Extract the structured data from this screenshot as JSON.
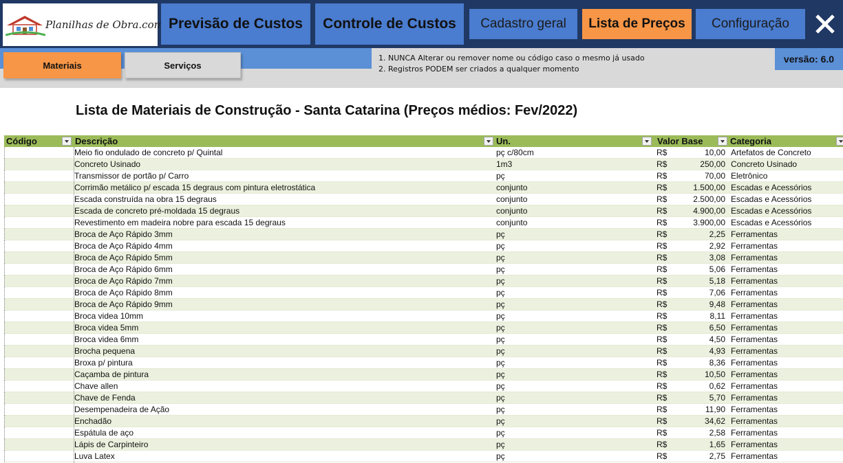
{
  "logo": {
    "text": "Planilhas de Obra.com"
  },
  "nav": {
    "previsao": "Previsão de Custos",
    "controle": "Controle de Custos",
    "cadastro": "Cadastro geral",
    "lista": "Lista de Preços",
    "config": "Configuração"
  },
  "tabs": {
    "materiais": "Materiais",
    "servicos": "Serviços"
  },
  "notes": [
    "1.  NUNCA Alterar ou remover nome ou código caso o mesmo já usado",
    "2.  Registros PODEM ser criados a qualquer momento"
  ],
  "version": "versão: 6.0",
  "title": "Lista de Materiais de Construção - Santa Catarina  (Preços médios: Fev/2022)",
  "columns": {
    "codigo": "Código",
    "descricao": "Descrição",
    "un": "Un.",
    "valor": "Valor Base",
    "categoria": "Categoria"
  },
  "currency": "R$",
  "rows": [
    {
      "codigo": "",
      "descricao": "Meio fio ondulado de concreto p/ Quintal",
      "un": "pç c/80cm",
      "valor": "10,00",
      "categoria": "Artefatos de Concreto"
    },
    {
      "codigo": "",
      "descricao": "Concreto Usinado",
      "un": "1m3",
      "valor": "250,00",
      "categoria": "Concreto Usinado"
    },
    {
      "codigo": "",
      "descricao": "Transmissor de portão p/ Carro",
      "un": "pç",
      "valor": "70,00",
      "categoria": "Eletrônico"
    },
    {
      "codigo": "",
      "descricao": "Corrimão metálico p/ escada 15 degraus com pintura eletrostática",
      "un": "conjunto",
      "valor": "1.500,00",
      "categoria": "Escadas e Acessórios"
    },
    {
      "codigo": "",
      "descricao": "Escada construída na obra 15 degraus",
      "un": "conjunto",
      "valor": "2.500,00",
      "categoria": "Escadas e Acessórios"
    },
    {
      "codigo": "",
      "descricao": "Escada de concreto pré-moldada 15 degraus",
      "un": "conjunto",
      "valor": "4.900,00",
      "categoria": "Escadas e Acessórios"
    },
    {
      "codigo": "",
      "descricao": "Revestimento em madeira nobre para escada 15 degraus",
      "un": "conjunto",
      "valor": "3.900,00",
      "categoria": "Escadas e Acessórios"
    },
    {
      "codigo": "",
      "descricao": "Broca de Aço Rápido 3mm",
      "un": "pç",
      "valor": "2,25",
      "categoria": "Ferramentas"
    },
    {
      "codigo": "",
      "descricao": "Broca de Aço Rápido 4mm",
      "un": "pç",
      "valor": "2,92",
      "categoria": "Ferramentas"
    },
    {
      "codigo": "",
      "descricao": "Broca de Aço Rápido 5mm",
      "un": "pç",
      "valor": "3,08",
      "categoria": "Ferramentas"
    },
    {
      "codigo": "",
      "descricao": "Broca de Aço Rápido 6mm",
      "un": "pç",
      "valor": "5,06",
      "categoria": "Ferramentas"
    },
    {
      "codigo": "",
      "descricao": "Broca de Aço Rápido 7mm",
      "un": "pç",
      "valor": "5,18",
      "categoria": "Ferramentas"
    },
    {
      "codigo": "",
      "descricao": "Broca de Aço Rápido 8mm",
      "un": "pç",
      "valor": "7,06",
      "categoria": "Ferramentas"
    },
    {
      "codigo": "",
      "descricao": "Broca de Aço Rápido 9mm",
      "un": "pç",
      "valor": "9,48",
      "categoria": "Ferramentas"
    },
    {
      "codigo": "",
      "descricao": "Broca videa 10mm",
      "un": "pç",
      "valor": "8,11",
      "categoria": "Ferramentas"
    },
    {
      "codigo": "",
      "descricao": "Broca videa 5mm",
      "un": "pç",
      "valor": "6,50",
      "categoria": "Ferramentas"
    },
    {
      "codigo": "",
      "descricao": "Broca videa 6mm",
      "un": "pç",
      "valor": "4,50",
      "categoria": "Ferramentas"
    },
    {
      "codigo": "",
      "descricao": "Brocha pequena",
      "un": "pç",
      "valor": "4,93",
      "categoria": "Ferramentas"
    },
    {
      "codigo": "",
      "descricao": "Broxa p/ pintura",
      "un": "pç",
      "valor": "8,36",
      "categoria": "Ferramentas"
    },
    {
      "codigo": "",
      "descricao": "Caçamba de pintura",
      "un": "pç",
      "valor": "10,50",
      "categoria": "Ferramentas"
    },
    {
      "codigo": "",
      "descricao": "Chave allen",
      "un": "pç",
      "valor": "0,62",
      "categoria": "Ferramentas"
    },
    {
      "codigo": "",
      "descricao": "Chave de Fenda",
      "un": "pç",
      "valor": "5,70",
      "categoria": "Ferramentas"
    },
    {
      "codigo": "",
      "descricao": "Desempenadeira de Ação",
      "un": "pç",
      "valor": "11,90",
      "categoria": "Ferramentas"
    },
    {
      "codigo": "",
      "descricao": "Enchadão",
      "un": "pç",
      "valor": "34,62",
      "categoria": "Ferramentas"
    },
    {
      "codigo": "",
      "descricao": "Espátula de aço",
      "un": "pç",
      "valor": "2,58",
      "categoria": "Ferramentas"
    },
    {
      "codigo": "",
      "descricao": "Lápis de Carpinteiro",
      "un": "pç",
      "valor": "1,65",
      "categoria": "Ferramentas"
    },
    {
      "codigo": "",
      "descricao": "Luva Latex",
      "un": "pç",
      "valor": "2,75",
      "categoria": "Ferramentas"
    }
  ]
}
